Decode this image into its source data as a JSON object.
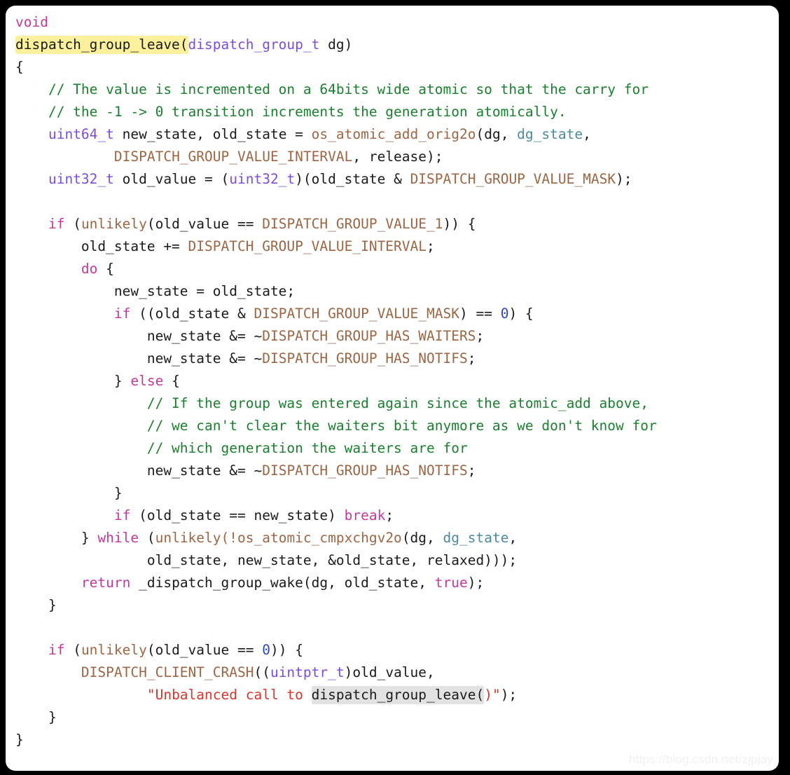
{
  "card": {
    "language": "c",
    "background": "#ffffff",
    "page_background": "#000000",
    "highlight_color": "#FBF09B",
    "secondary_highlight_color": "#E2E2E2"
  },
  "palette": {
    "plain": "#1a1a1a",
    "keyword": "#C2389B",
    "type": "#7C4DD8",
    "comment": "#1A7F2E",
    "macro": "#9C6644",
    "field": "#4B8B9B",
    "number": "#2E45C8",
    "string": "#D8342B"
  },
  "code": {
    "l01_void": "void",
    "l02_fn_name": "dispatch_group_leave(",
    "l02_param_type": "dispatch_group_t",
    "l02_param_rest": " dg)",
    "l03_open_brace": "{",
    "l04_comment": "    // The value is incremented on a 64bits wide atomic so that the carry for",
    "l05_comment": "    // the -1 -> 0 transition increments the generation atomically.",
    "l06_indent": "    ",
    "l06_type": "uint64_t",
    "l06_mid": " new_state, old_state = ",
    "l06_call": "os_atomic_add_orig2o",
    "l06_args1": "(dg, ",
    "l06_field": "dg_state",
    "l06_tail": ",",
    "l07_indent": "            ",
    "l07_macro": "DISPATCH_GROUP_VALUE_INTERVAL",
    "l07_tail": ", release);",
    "l08_indent": "    ",
    "l08_type1": "uint32_t",
    "l08_mid1": " old_value = (",
    "l08_type2": "uint32_t",
    "l08_mid2": ")(old_state & ",
    "l08_macro": "DISPATCH_GROUP_VALUE_MASK",
    "l08_tail": ");",
    "l09_blank": "",
    "l10_indent": "    ",
    "l10_if": "if",
    "l10_paren": " (",
    "l10_unlikely": "unlikely",
    "l10_mid": "(old_value == ",
    "l10_macro": "DISPATCH_GROUP_VALUE_1",
    "l10_tail": ")) {",
    "l11_indent": "        ",
    "l11_mid": "old_state += ",
    "l11_macro": "DISPATCH_GROUP_VALUE_INTERVAL",
    "l11_tail": ";",
    "l12_indent": "        ",
    "l12_do": "do",
    "l12_tail": " {",
    "l13_text": "            new_state = old_state;",
    "l14_indent": "            ",
    "l14_if": "if",
    "l14_mid1": " ((old_state & ",
    "l14_macro": "DISPATCH_GROUP_VALUE_MASK",
    "l14_mid2": ") == ",
    "l14_num": "0",
    "l14_tail": ") {",
    "l15_indent": "                ",
    "l15_mid": "new_state &= ~",
    "l15_macro": "DISPATCH_GROUP_HAS_WAITERS",
    "l15_tail": ";",
    "l16_indent": "                ",
    "l16_mid": "new_state &= ~",
    "l16_macro": "DISPATCH_GROUP_HAS_NOTIFS",
    "l16_tail": ";",
    "l17_indent": "            ",
    "l17_close": "} ",
    "l17_else": "else",
    "l17_tail": " {",
    "l18_comment": "                // If the group was entered again since the atomic_add above,",
    "l19_comment": "                // we can't clear the waiters bit anymore as we don't know for",
    "l20_comment": "                // which generation the waiters are for",
    "l21_indent": "                ",
    "l21_mid": "new_state &= ~",
    "l21_macro": "DISPATCH_GROUP_HAS_NOTIFS",
    "l21_tail": ";",
    "l22_text": "            }",
    "l23_indent": "            ",
    "l23_if": "if",
    "l23_mid": " (old_state == new_state) ",
    "l23_break": "break",
    "l23_tail": ";",
    "l24_indent": "        ",
    "l24_close": "} ",
    "l24_while": "while",
    "l24_paren": " (",
    "l24_unlikely": "unlikely",
    "l24_bang": "(!",
    "l24_call": "os_atomic_cmpxchgv2o",
    "l24_args": "(dg, ",
    "l24_field": "dg_state",
    "l24_tail": ",",
    "l25_text": "                old_state, new_state, &old_state, relaxed)));",
    "l26_indent": "        ",
    "l26_return": "return",
    "l26_mid": " _dispatch_group_wake(dg, old_state, ",
    "l26_true": "true",
    "l26_tail": ");",
    "l27_text": "    }",
    "l28_blank": "",
    "l29_indent": "    ",
    "l29_if": "if",
    "l29_paren": " (",
    "l29_unlikely": "unlikely",
    "l29_mid": "(old_value == ",
    "l29_num": "0",
    "l29_tail": ")) {",
    "l30_indent": "        ",
    "l30_macro": "DISPATCH_CLIENT_CRASH",
    "l30_mid1": "((",
    "l30_type": "uintptr_t",
    "l30_tail": ")old_value,",
    "l31_indent": "                ",
    "l31_str_open": "\"Unbalanced call to ",
    "l31_hl": "dispatch_group_leave(",
    "l31_str_close": ")\"",
    "l31_tail": ");",
    "l32_text": "    }",
    "l33_text": "}"
  },
  "watermark": {
    "text": "https://blog.csdn.net/zjpjay"
  }
}
